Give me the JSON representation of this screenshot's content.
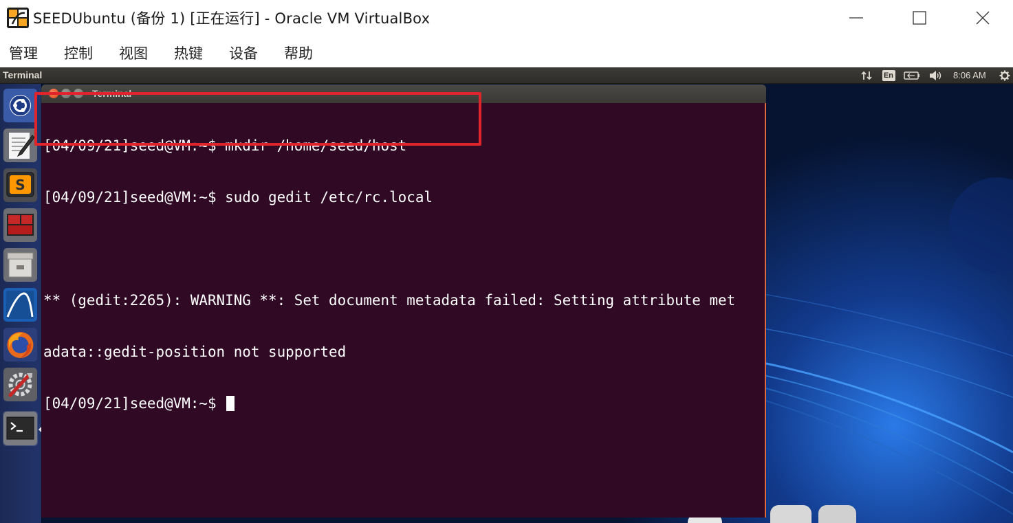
{
  "host_window": {
    "title": "SEEDUbuntu (备份 1) [正在运行] - Oracle VM VirtualBox",
    "logo_icon": "virtualbox-logo-icon",
    "controls": [
      "minimize-icon",
      "maximize-icon",
      "close-icon"
    ]
  },
  "menubar": {
    "items": [
      "管理",
      "控制",
      "视图",
      "热键",
      "设备",
      "帮助"
    ]
  },
  "guest": {
    "top_panel": {
      "app_name": "Terminal",
      "indicators": [
        "network-arrows-icon",
        "keyboard-layout-indicator",
        "battery-icon",
        "volume-icon",
        "power-gear-icon"
      ],
      "keyboard_layout": "En",
      "clock": "8:06 AM"
    },
    "launcher": {
      "items": [
        "ubuntu-dash-icon",
        "text-editor-icon",
        "sublime-text-icon",
        "terminator-icon",
        "file-manager-icon",
        "wireshark-icon",
        "firefox-icon",
        "system-settings-icon",
        "terminal-icon"
      ]
    },
    "terminal": {
      "title": "Terminal",
      "lines": [
        "[04/09/21]seed@VM:~$ mkdir /home/seed/host",
        "[04/09/21]seed@VM:~$ sudo gedit /etc/rc.local",
        "",
        "** (gedit:2265): WARNING **: Set document metadata failed: Setting attribute met",
        "adata::gedit-position not supported",
        "[04/09/21]seed@VM:~$ "
      ]
    }
  },
  "colors": {
    "terminal_bg": "#300a24",
    "highlight_box": "#e0242c",
    "desktop_blue": "#0b1d4f"
  }
}
